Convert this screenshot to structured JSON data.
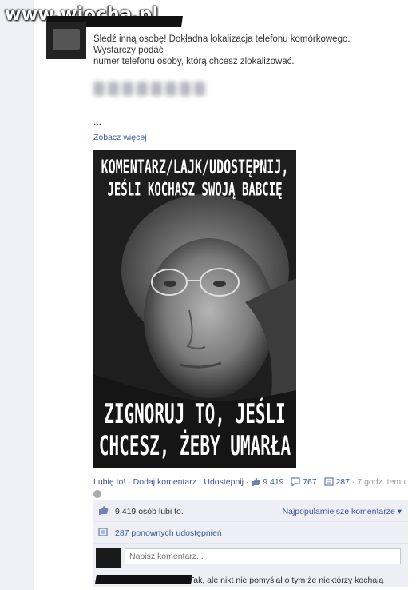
{
  "watermark": "www.wiocha.pl",
  "post": {
    "lines": [
      "Śledź inną osobę! Dokładna lokalizacja telefonu komórkowego.",
      "Wystarczy podać",
      "numer telefonu osoby, którą chcesz zlokalizować."
    ],
    "ellipsis": "...",
    "see_more": "Zobacz więcej"
  },
  "image": {
    "top_line1": "Komentarz/Lajk/Udostępnij,",
    "top_line2": "Jeśli kochasz swoją babcię",
    "bottom_line1": "Zignoruj to, jeśli",
    "bottom_line2": "chcesz, żeby umarła"
  },
  "actions": {
    "like": "Lubię to!",
    "sep": "·",
    "comment": "Dodaj komentarz",
    "share": "Udostępnij",
    "likes_count": "9.419",
    "comments_count": "767",
    "shares_count": "287",
    "time": "7 godz. temu"
  },
  "ufi": {
    "likes_text": "9.419 osób lubi to.",
    "top_comments": "Najpopularniejsze komentarze ▾",
    "shares_text": "287 ponownych udostępnień",
    "comment_placeholder": "Napisz komentarz...",
    "comment_preview": "Tak, ale nikt nie pomyślał o tym że niektórzy kochają"
  },
  "colors": {
    "link": "#3b5998",
    "ufi_bg": "#edeff4"
  }
}
